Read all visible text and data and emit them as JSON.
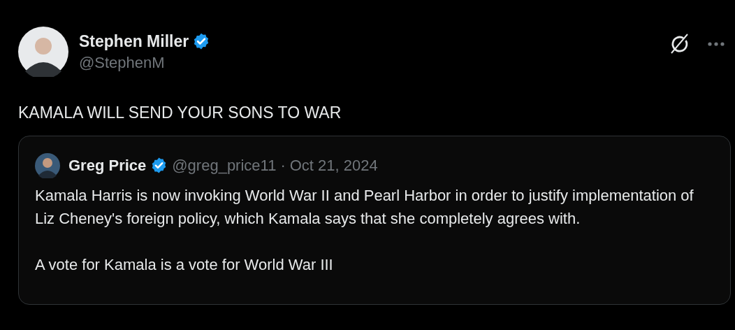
{
  "post": {
    "author": {
      "name": "Stephen Miller",
      "verified": true,
      "handle": "@StephenM"
    },
    "text": "KAMALA WILL SEND YOUR SONS TO WAR",
    "quote": {
      "author": {
        "name": "Greg Price",
        "verified": true,
        "handle": "@greg_price11"
      },
      "separator": "·",
      "date": "Oct 21, 2024",
      "paragraphs": [
        "Kamala Harris is now invoking World War II and Pearl Harbor in order to justify implementation of Liz Cheney's foreign policy, which Kamala says that she completely agrees with.",
        "A vote for Kamala is a vote for World War III"
      ]
    }
  }
}
